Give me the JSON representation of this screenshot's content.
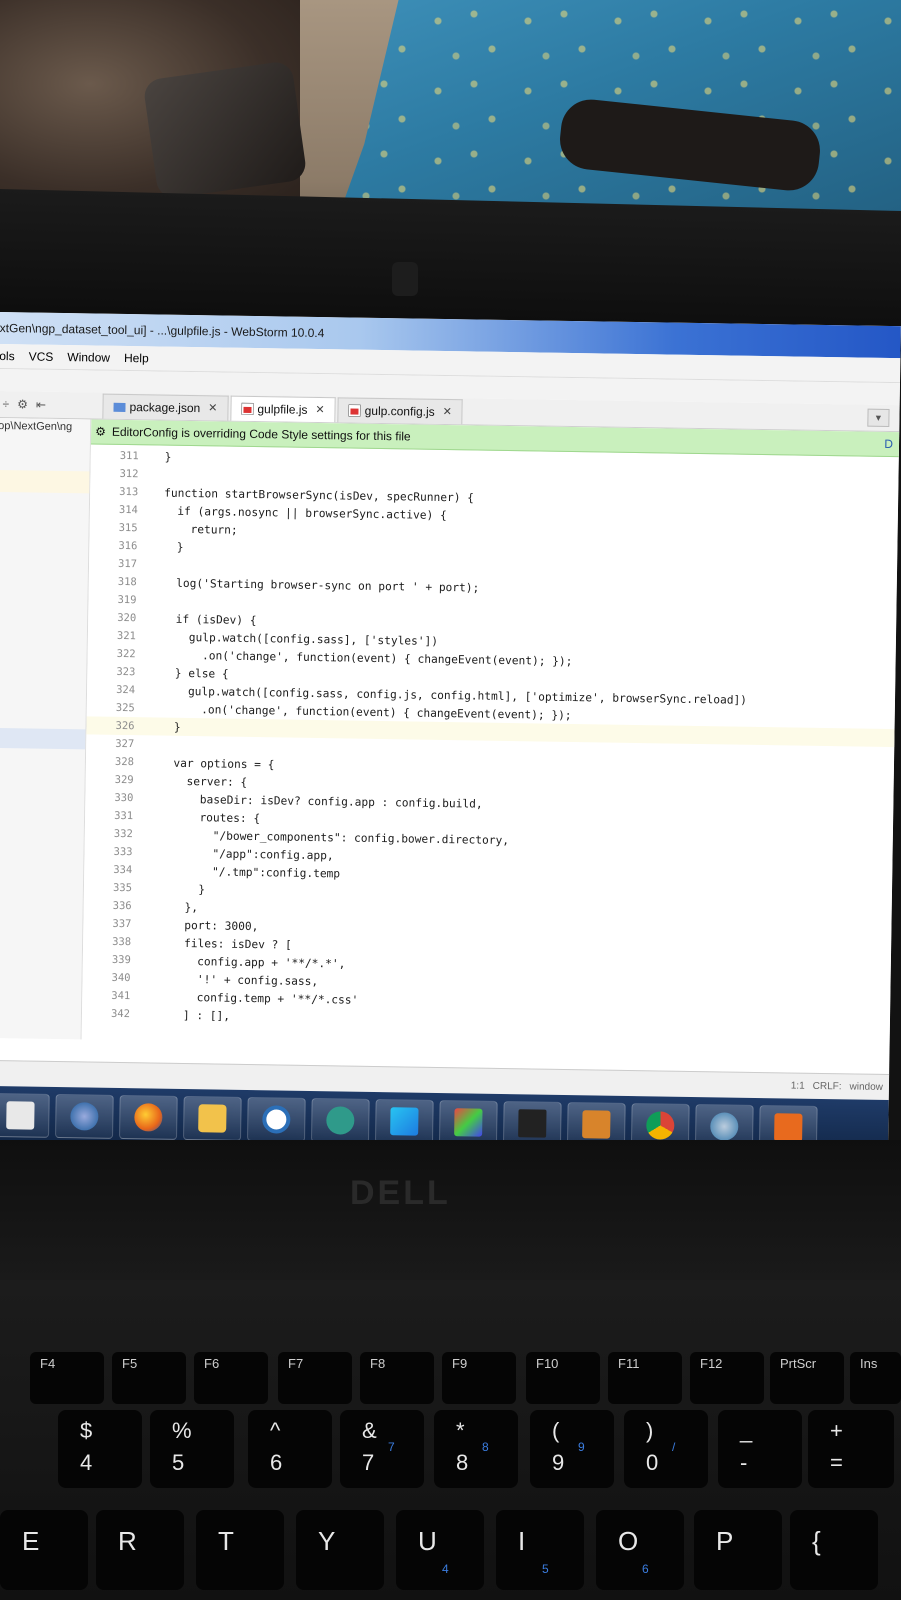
{
  "window": {
    "title": "xtGen\\ngp_dataset_tool_ui] - ...\\gulpfile.js - WebStorm 10.0.4"
  },
  "menu": {
    "items": [
      "ols",
      "VCS",
      "Window",
      "Help"
    ]
  },
  "tabs": [
    {
      "label": "package.json",
      "active": false
    },
    {
      "label": "gulpfile.js",
      "active": true
    },
    {
      "label": "gulp.config.js",
      "active": false
    }
  ],
  "project_panel": {
    "path": "op\\NextGen\\ng"
  },
  "notice": {
    "text": "EditorConfig is overriding Code Style settings for this file",
    "link": "D"
  },
  "code_lines": [
    {
      "n": "311",
      "t": "}"
    },
    {
      "n": "312",
      "t": ""
    },
    {
      "n": "313",
      "t": "function startBrowserSync(isDev, specRunner) {"
    },
    {
      "n": "314",
      "t": "  if (args.nosync || browserSync.active) {"
    },
    {
      "n": "315",
      "t": "    return;"
    },
    {
      "n": "316",
      "t": "  }"
    },
    {
      "n": "317",
      "t": ""
    },
    {
      "n": "318",
      "t": "  log('Starting browser-sync on port ' + port);"
    },
    {
      "n": "319",
      "t": ""
    },
    {
      "n": "320",
      "t": "  if (isDev) {"
    },
    {
      "n": "321",
      "t": "    gulp.watch([config.sass], ['styles'])"
    },
    {
      "n": "322",
      "t": "      .on('change', function(event) { changeEvent(event); });"
    },
    {
      "n": "323",
      "t": "  } else {"
    },
    {
      "n": "324",
      "t": "    gulp.watch([config.sass, config.js, config.html], ['optimize', browserSync.reload])"
    },
    {
      "n": "325",
      "t": "      .on('change', function(event) { changeEvent(event); });"
    },
    {
      "n": "326",
      "t": "  }"
    },
    {
      "n": "327",
      "t": ""
    },
    {
      "n": "328",
      "t": "  var options = {"
    },
    {
      "n": "329",
      "t": "    server: {"
    },
    {
      "n": "330",
      "t": "      baseDir: isDev? config.app : config.build,"
    },
    {
      "n": "331",
      "t": "      routes: {"
    },
    {
      "n": "332",
      "t": "        \"/bower_components\": config.bower.directory,"
    },
    {
      "n": "333",
      "t": "        \"/app\":config.app,"
    },
    {
      "n": "334",
      "t": "        \"/.tmp\":config.temp"
    },
    {
      "n": "335",
      "t": "      }"
    },
    {
      "n": "336",
      "t": "    },"
    },
    {
      "n": "337",
      "t": "    port: 3000,"
    },
    {
      "n": "338",
      "t": "    files: isDev ? ["
    },
    {
      "n": "339",
      "t": "      config.app + '**/*.*',"
    },
    {
      "n": "340",
      "t": "      '!' + config.sass,"
    },
    {
      "n": "341",
      "t": "      config.temp + '**/*.css'"
    },
    {
      "n": "342",
      "t": "    ] : [],"
    }
  ],
  "status": {
    "position": "1:1",
    "line_sep": "CRLF:",
    "encoding": "window"
  },
  "keyboard": {
    "fn_keys": [
      "F4",
      "F5",
      "F6",
      "F7",
      "F8",
      "F9",
      "F10",
      "F11",
      "F12",
      "PrtScr",
      "Ins"
    ],
    "num_keys": [
      {
        "top": "$",
        "bot": "4"
      },
      {
        "top": "%",
        "bot": "5"
      },
      {
        "top": "^",
        "bot": "6"
      },
      {
        "top": "&",
        "bot": "7",
        "blue": "7"
      },
      {
        "top": "*",
        "bot": "8",
        "blue": "8"
      },
      {
        "top": "(",
        "bot": "9",
        "blue": "9"
      },
      {
        "top": ")",
        "bot": "0",
        "blue": "/"
      },
      {
        "top": "_",
        "bot": "-"
      },
      {
        "top": "+",
        "bot": "="
      }
    ],
    "letter_keys": [
      {
        "l": "E"
      },
      {
        "l": "R"
      },
      {
        "l": "T"
      },
      {
        "l": "Y"
      },
      {
        "l": "U",
        "blue": "4"
      },
      {
        "l": "I",
        "blue": "5"
      },
      {
        "l": "O",
        "blue": "6"
      },
      {
        "l": "P"
      },
      {
        "l": "{"
      }
    ]
  },
  "brand": "DELL",
  "colors": {
    "notice_bg": "#c9f0bd",
    "taskbar": "#1f3b68",
    "titlebar_accent": "#2457c6"
  }
}
